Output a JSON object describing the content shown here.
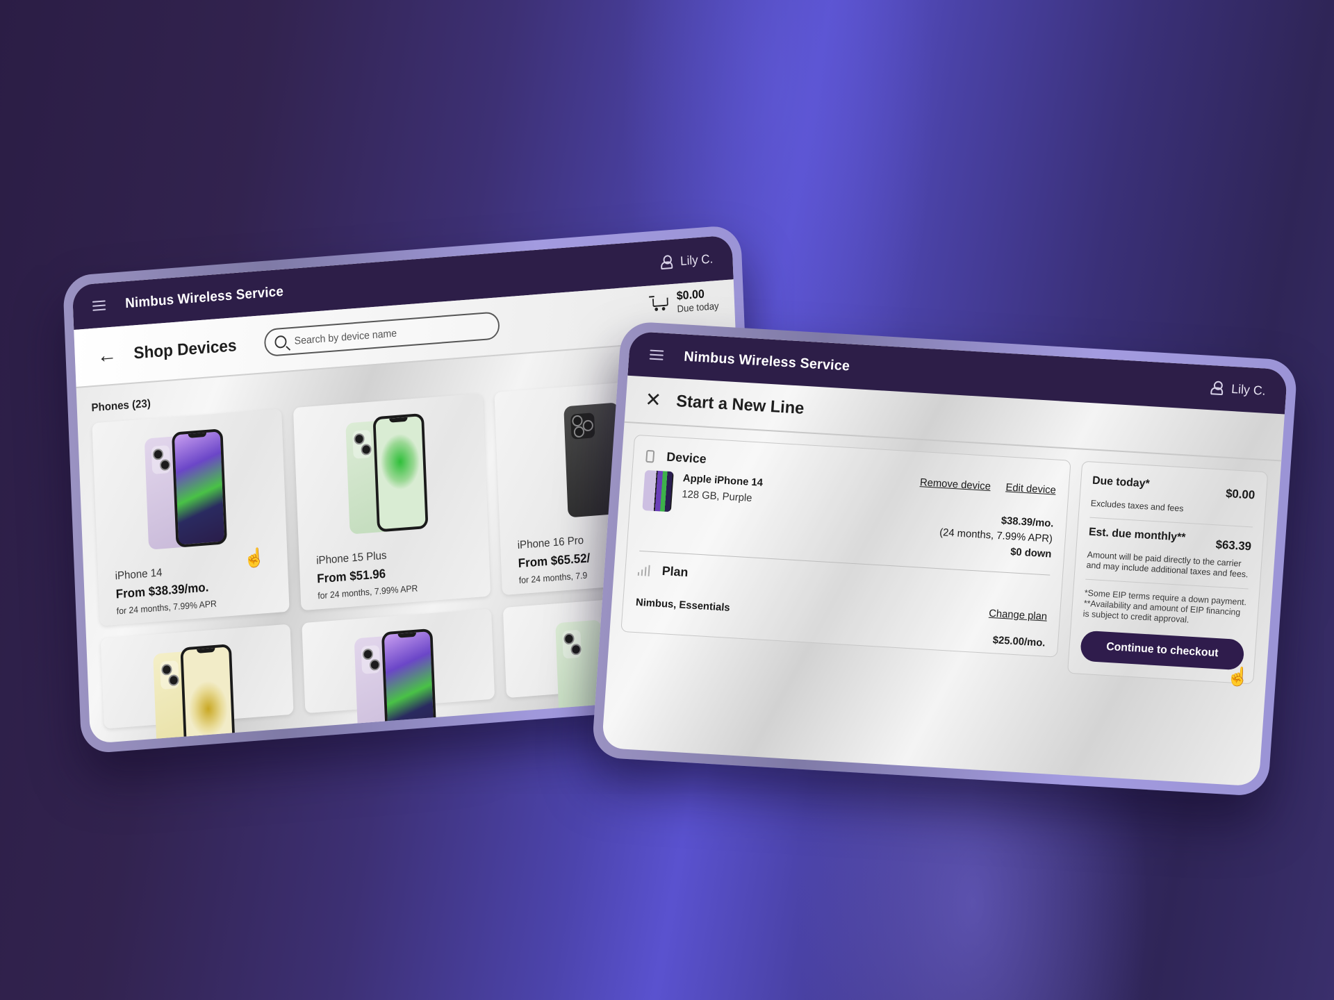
{
  "colors": {
    "brand_bar": "#2d1e48",
    "button": "#2f1c4c",
    "background_dark": "#2b1d45",
    "background_light": "#5a52cf"
  },
  "shop": {
    "topbar": {
      "brand": "Nimbus Wireless Service",
      "user_name": "Lily C.",
      "menu_icon": "hamburger-icon",
      "user_icon": "person-icon"
    },
    "header": {
      "title": "Shop Devices",
      "back_icon": "arrow-left-icon",
      "search_placeholder": "Search by device name",
      "cart": {
        "total": "$0.00",
        "label": "Due today",
        "icon": "cart-icon"
      }
    },
    "section_title": "Phones (23)",
    "products": [
      {
        "name": "iPhone 14",
        "price": "From $38.39/mo.",
        "terms": "for 24 months, 7.99% APR",
        "color": "purple"
      },
      {
        "name": "iPhone 15 Plus",
        "price": "From $51.96",
        "terms": "for 24 months, 7.99% APR",
        "color": "green"
      },
      {
        "name": "iPhone 16 Pro",
        "price": "From $65.52/",
        "terms": "for 24 months, 7.9",
        "color": "black"
      },
      {
        "name": "",
        "price": "",
        "terms": "",
        "color": "yellow"
      },
      {
        "name": "",
        "price": "",
        "terms": "",
        "color": "purple"
      },
      {
        "name": "",
        "price": "",
        "terms": "",
        "color": "green"
      }
    ]
  },
  "line": {
    "topbar": {
      "brand": "Nimbus Wireless Service",
      "user_name": "Lily C."
    },
    "title": "Start a New Line",
    "device": {
      "label": "Device",
      "name": "Apple iPhone 14",
      "spec": "128 GB, Purple",
      "remove_label": "Remove device",
      "edit_label": "Edit device",
      "monthly": "$38.39/mo.",
      "terms": "(24 months, 7.99% APR)",
      "down": "$0 down"
    },
    "plan": {
      "label": "Plan",
      "name": "Nimbus, Essentials",
      "change_label": "Change plan",
      "price": "$25.00/mo."
    },
    "summary": {
      "due_today_label": "Due today*",
      "due_today_amount": "$0.00",
      "due_today_note": "Excludes taxes and fees",
      "monthly_label": "Est. due monthly**",
      "monthly_amount": "$63.39",
      "monthly_note": "Amount will be paid directly to the carrier and may include additional taxes and fees.",
      "footnote_1": "*Some EIP terms require a down payment.",
      "footnote_2": "**Availability and amount of EIP financing is subject to credit approval.",
      "checkout_label": "Continue to checkout"
    }
  }
}
